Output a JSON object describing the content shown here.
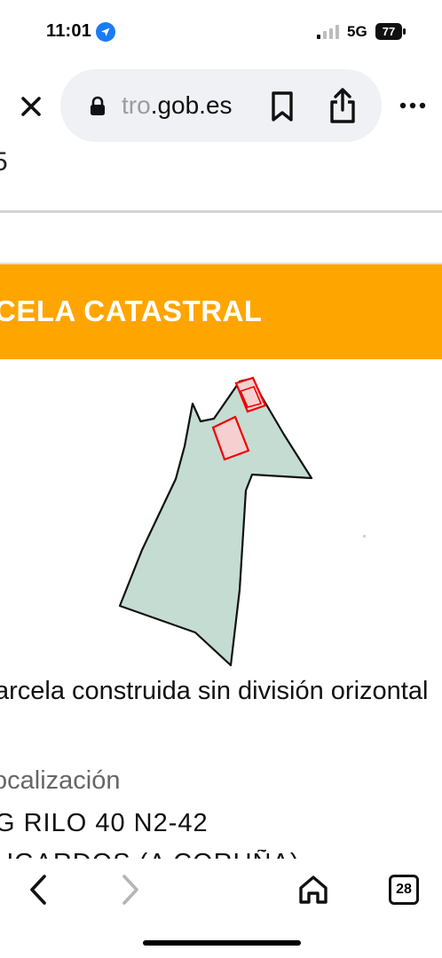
{
  "status_bar": {
    "time": "11:01",
    "network": "5G",
    "battery": "77"
  },
  "browser": {
    "url_faded": "tro",
    "url_main": ".gob.es"
  },
  "content": {
    "top_truncated_text": "5",
    "section_title": "CELA CATASTRAL",
    "description": "arcela construida sin división orizontal",
    "location_label": "ocalización",
    "address_line1": "G RILO 40 N2-42",
    "address_line2": "UGARDOS (A CORUÑA)"
  },
  "toolbar": {
    "tab_count": "28"
  },
  "colors": {
    "banner": "#ffa500",
    "parcel_fill": "#c5dcd3",
    "building_outline": "#ee0000"
  }
}
